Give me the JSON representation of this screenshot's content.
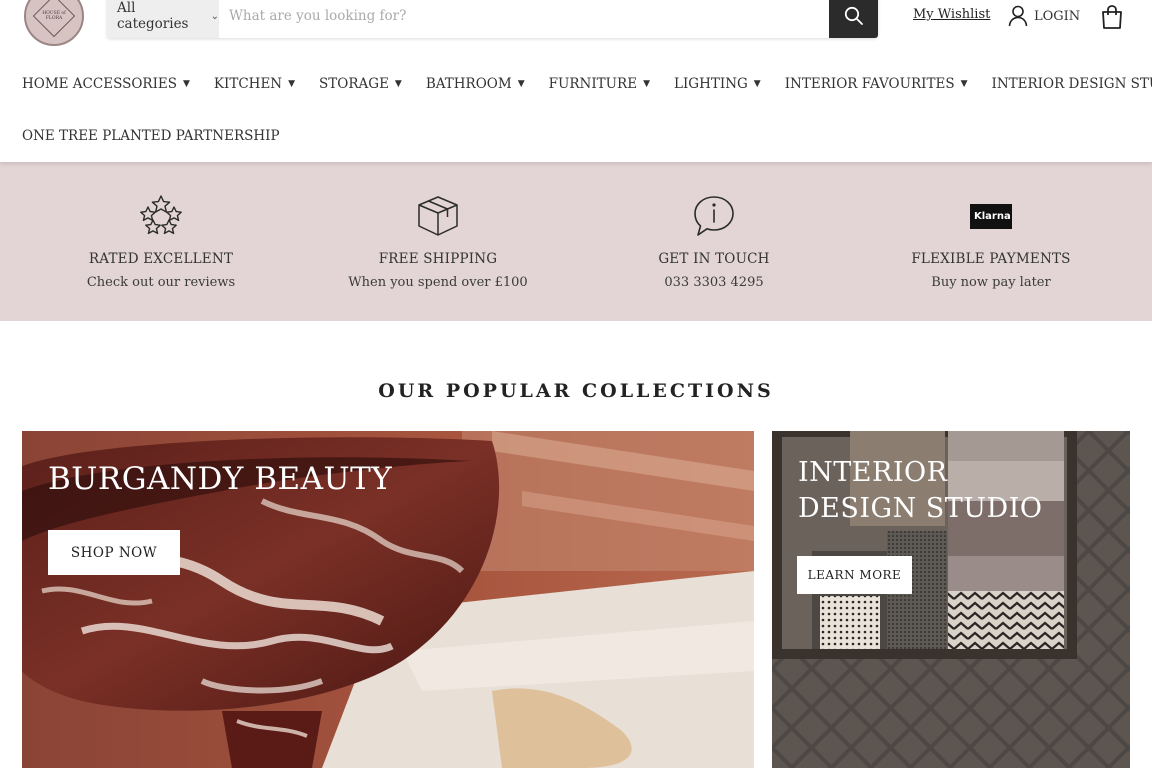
{
  "logo": {
    "text": "HOUSE of FLORA"
  },
  "search": {
    "category_label": "All categories",
    "placeholder": "What are you looking for?"
  },
  "header": {
    "wishlist": "My Wishlist",
    "login": "LOGIN"
  },
  "nav": {
    "row1": [
      {
        "label": "HOME ACCESSORIES",
        "has_dropdown": true
      },
      {
        "label": "KITCHEN",
        "has_dropdown": true
      },
      {
        "label": "STORAGE",
        "has_dropdown": true
      },
      {
        "label": "BATHROOM",
        "has_dropdown": true
      },
      {
        "label": "FURNITURE",
        "has_dropdown": true
      },
      {
        "label": "LIGHTING",
        "has_dropdown": true
      },
      {
        "label": "INTERIOR FAVOURITES",
        "has_dropdown": true
      },
      {
        "label": "INTERIOR DESIGN STUDIO",
        "has_dropdown": false
      }
    ],
    "row2": [
      {
        "label": "ONE TREE PLANTED PARTNERSHIP",
        "has_dropdown": false
      }
    ]
  },
  "features": [
    {
      "icon": "stars-icon",
      "title": "RATED EXCELLENT",
      "subtitle": "Check out our reviews"
    },
    {
      "icon": "box-icon",
      "title": "FREE SHIPPING",
      "subtitle": "When you spend over £100"
    },
    {
      "icon": "info-bubble-icon",
      "title": "GET IN TOUCH",
      "subtitle": "033 3303 4295"
    },
    {
      "icon": "klarna-logo",
      "badge": "Klarna",
      "title": "FLEXIBLE PAYMENTS",
      "subtitle": "Buy now pay later"
    }
  ],
  "collections": {
    "heading": "OUR POPULAR COLLECTIONS",
    "cards": [
      {
        "title": "BURGANDY BEAUTY",
        "button": "SHOP NOW"
      },
      {
        "title_line1": "INTERIOR",
        "title_line2": "DESIGN STUDIO",
        "button": "LEARN MORE"
      }
    ]
  },
  "colors": {
    "features_band": "#e3d5d5",
    "dark": "#2b2b2b",
    "logo_bg": "#d8c3c3"
  }
}
